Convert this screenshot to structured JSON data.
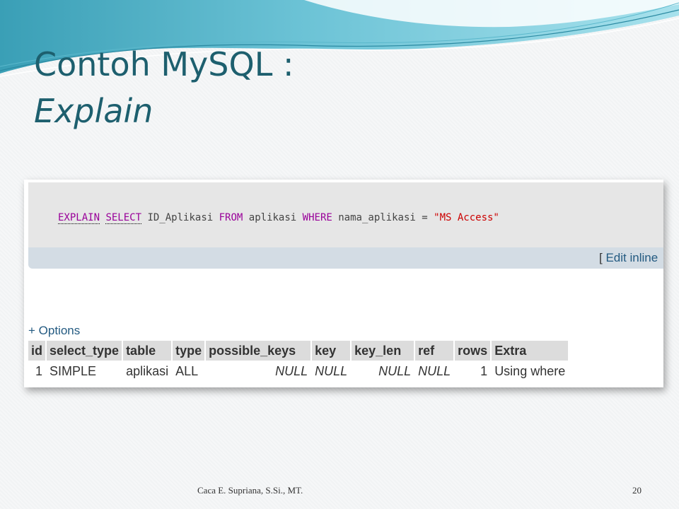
{
  "slide": {
    "title_line1": "Contoh MySQL :",
    "title_line2": "Explain",
    "footer_author": "Caca E. Supriana, S.Si., MT.",
    "page_number": "20"
  },
  "query": {
    "kw_explain": "EXPLAIN",
    "kw_select": "SELECT",
    "col": "ID_Aplikasi",
    "kw_from": "FROM",
    "tbl": "aplikasi",
    "kw_where": "WHERE",
    "cond_col": "nama_aplikasi",
    "op": "=",
    "value": "\"MS Access\"",
    "edit_bracket": "[",
    "edit_link": "Edit inline"
  },
  "result": {
    "options_label": "+ Options",
    "headers": [
      "id",
      "select_type",
      "table",
      "type",
      "possible_keys",
      "key",
      "key_len",
      "ref",
      "rows",
      "Extra"
    ],
    "row": [
      "1",
      "SIMPLE",
      "aplikasi",
      "ALL",
      "NULL",
      "NULL",
      "NULL",
      "NULL",
      "1",
      "Using where"
    ]
  },
  "colors": {
    "title": "#1d5f6e",
    "keyword": "#990099",
    "string": "#cc0000",
    "link": "#235a81",
    "header_bg": "#dcdcdc"
  }
}
